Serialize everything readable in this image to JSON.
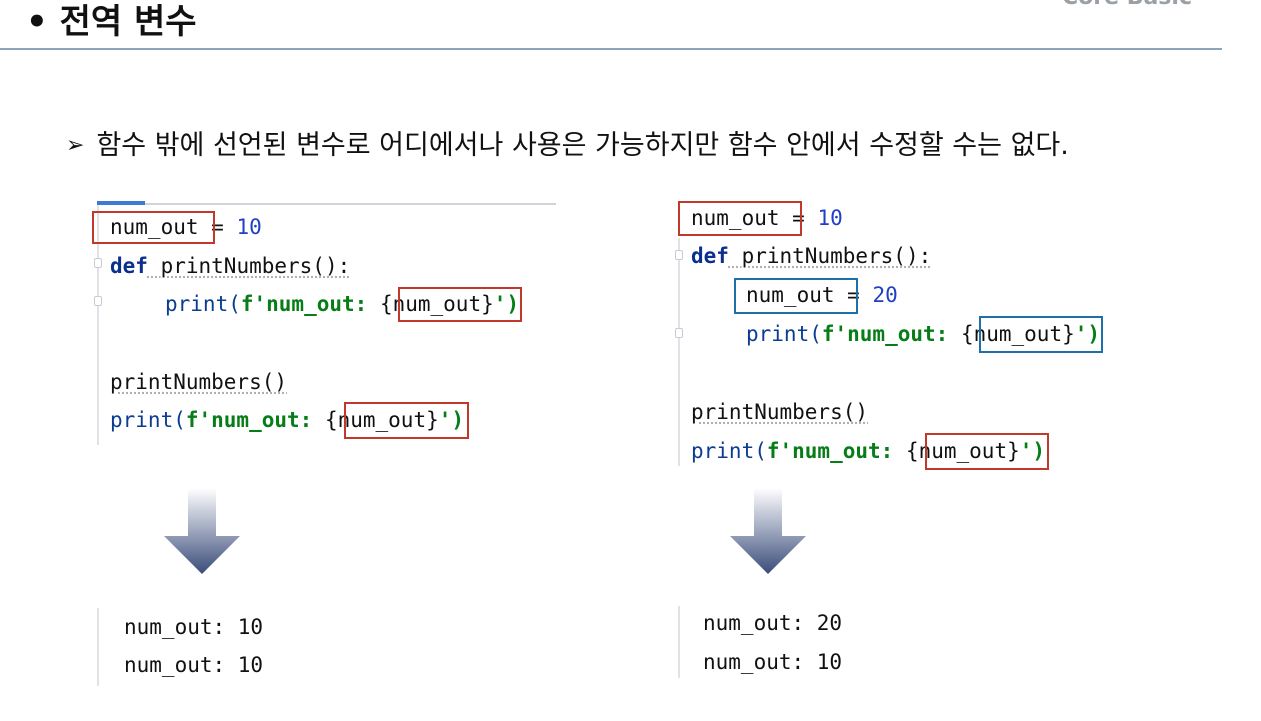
{
  "header": {
    "title": "• 전역 변수",
    "corner_text": "Core Basic"
  },
  "bullet": {
    "marker": "➢",
    "text": "함수 밖에 선언된 변수로 어디에서나 사용은 가능하지만 함수 안에서 수정할 수는 없다."
  },
  "left_example": {
    "code": {
      "l1_var": "num_out",
      "l1_rest": " = ",
      "l1_num": "10",
      "l2_kw": "def",
      "l2_fn": " printNumbers():",
      "l3_print": "print(",
      "l3_str": "f'num_out: ",
      "l3_expr": "{num_out}",
      "l3_end": "')",
      "l5_call": "printNumbers()",
      "l6_print": "print(",
      "l6_str": "f'num_out: ",
      "l6_expr": "{num_out}",
      "l6_end": "')"
    },
    "output": [
      "num_out: 10",
      "num_out: 10"
    ]
  },
  "right_example": {
    "code": {
      "l1_var": "num_out",
      "l1_rest": " = ",
      "l1_num": "10",
      "l2_kw": "def",
      "l2_fn": " printNumbers():",
      "l3_var": "num_out",
      "l3_rest": " = ",
      "l3_num": "20",
      "l4_print": "print(",
      "l4_str": "f'num_out: ",
      "l4_expr": "{num_out}",
      "l4_end": "')",
      "l6_call": "printNumbers()",
      "l7_print": "print(",
      "l7_str": "f'num_out: ",
      "l7_expr": "{num_out}",
      "l7_end": "')"
    },
    "output": [
      "num_out: 20",
      "num_out: 10"
    ]
  },
  "colors": {
    "highlight_global": "#c0392b",
    "highlight_local": "#1f6fa8",
    "arrow_gradient_top": "#ffffff",
    "arrow_gradient_bottom": "#3a4c7a"
  }
}
